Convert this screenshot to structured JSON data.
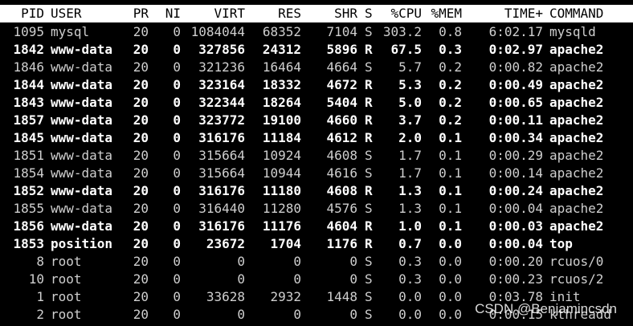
{
  "header": {
    "pid": "PID",
    "user": "USER",
    "pr": "PR",
    "ni": "NI",
    "virt": "VIRT",
    "res": "RES",
    "shr": "SHR",
    "s": "S",
    "cpu": "%CPU",
    "mem": "%MEM",
    "time": "TIME+",
    "command": "COMMAND"
  },
  "processes": [
    {
      "pid": "1095",
      "user": "mysql",
      "pr": "20",
      "ni": "0",
      "virt": "1084044",
      "res": "68352",
      "shr": "7104",
      "s": "S",
      "cpu": "303.2",
      "mem": "0.8",
      "time": "6:02.17",
      "command": "mysqld",
      "bold": false
    },
    {
      "pid": "1842",
      "user": "www-data",
      "pr": "20",
      "ni": "0",
      "virt": "327856",
      "res": "24312",
      "shr": "5896",
      "s": "R",
      "cpu": "67.5",
      "mem": "0.3",
      "time": "0:02.97",
      "command": "apache2",
      "bold": true
    },
    {
      "pid": "1846",
      "user": "www-data",
      "pr": "20",
      "ni": "0",
      "virt": "321236",
      "res": "16464",
      "shr": "4664",
      "s": "S",
      "cpu": "5.7",
      "mem": "0.2",
      "time": "0:00.82",
      "command": "apache2",
      "bold": false
    },
    {
      "pid": "1844",
      "user": "www-data",
      "pr": "20",
      "ni": "0",
      "virt": "323164",
      "res": "18332",
      "shr": "4672",
      "s": "R",
      "cpu": "5.3",
      "mem": "0.2",
      "time": "0:00.49",
      "command": "apache2",
      "bold": true
    },
    {
      "pid": "1843",
      "user": "www-data",
      "pr": "20",
      "ni": "0",
      "virt": "322344",
      "res": "18264",
      "shr": "5404",
      "s": "R",
      "cpu": "5.0",
      "mem": "0.2",
      "time": "0:00.65",
      "command": "apache2",
      "bold": true
    },
    {
      "pid": "1857",
      "user": "www-data",
      "pr": "20",
      "ni": "0",
      "virt": "323772",
      "res": "19100",
      "shr": "4660",
      "s": "R",
      "cpu": "3.7",
      "mem": "0.2",
      "time": "0:00.11",
      "command": "apache2",
      "bold": true
    },
    {
      "pid": "1845",
      "user": "www-data",
      "pr": "20",
      "ni": "0",
      "virt": "316176",
      "res": "11184",
      "shr": "4612",
      "s": "R",
      "cpu": "2.0",
      "mem": "0.1",
      "time": "0:00.34",
      "command": "apache2",
      "bold": true
    },
    {
      "pid": "1851",
      "user": "www-data",
      "pr": "20",
      "ni": "0",
      "virt": "315664",
      "res": "10924",
      "shr": "4608",
      "s": "S",
      "cpu": "1.7",
      "mem": "0.1",
      "time": "0:00.29",
      "command": "apache2",
      "bold": false
    },
    {
      "pid": "1854",
      "user": "www-data",
      "pr": "20",
      "ni": "0",
      "virt": "315664",
      "res": "10944",
      "shr": "4616",
      "s": "S",
      "cpu": "1.7",
      "mem": "0.1",
      "time": "0:00.14",
      "command": "apache2",
      "bold": false
    },
    {
      "pid": "1852",
      "user": "www-data",
      "pr": "20",
      "ni": "0",
      "virt": "316176",
      "res": "11180",
      "shr": "4608",
      "s": "R",
      "cpu": "1.3",
      "mem": "0.1",
      "time": "0:00.24",
      "command": "apache2",
      "bold": true
    },
    {
      "pid": "1855",
      "user": "www-data",
      "pr": "20",
      "ni": "0",
      "virt": "316440",
      "res": "11280",
      "shr": "4576",
      "s": "S",
      "cpu": "1.3",
      "mem": "0.1",
      "time": "0:00.04",
      "command": "apache2",
      "bold": false
    },
    {
      "pid": "1856",
      "user": "www-data",
      "pr": "20",
      "ni": "0",
      "virt": "316176",
      "res": "11176",
      "shr": "4604",
      "s": "R",
      "cpu": "1.0",
      "mem": "0.1",
      "time": "0:00.03",
      "command": "apache2",
      "bold": true
    },
    {
      "pid": "1853",
      "user": "position",
      "pr": "20",
      "ni": "0",
      "virt": "23672",
      "res": "1704",
      "shr": "1176",
      "s": "R",
      "cpu": "0.7",
      "mem": "0.0",
      "time": "0:00.04",
      "command": "top",
      "bold": true
    },
    {
      "pid": "8",
      "user": "root",
      "pr": "20",
      "ni": "0",
      "virt": "0",
      "res": "0",
      "shr": "0",
      "s": "S",
      "cpu": "0.3",
      "mem": "0.0",
      "time": "0:00.20",
      "command": "rcuos/0",
      "bold": false
    },
    {
      "pid": "10",
      "user": "root",
      "pr": "20",
      "ni": "0",
      "virt": "0",
      "res": "0",
      "shr": "0",
      "s": "S",
      "cpu": "0.3",
      "mem": "0.0",
      "time": "0:00.23",
      "command": "rcuos/2",
      "bold": false
    },
    {
      "pid": "1",
      "user": "root",
      "pr": "20",
      "ni": "0",
      "virt": "33628",
      "res": "2932",
      "shr": "1448",
      "s": "S",
      "cpu": "0.0",
      "mem": "0.0",
      "time": "0:03.78",
      "command": "init",
      "bold": false
    },
    {
      "pid": "2",
      "user": "root",
      "pr": "20",
      "ni": "0",
      "virt": "0",
      "res": "0",
      "shr": "0",
      "s": "S",
      "cpu": "0.0",
      "mem": "0.0",
      "time": "0:00.15",
      "command": "kthreadd",
      "bold": false
    }
  ],
  "watermark": "CSDN @Benjamincsdn",
  "colors": {
    "background": "#000000",
    "header_background": "#ffffff",
    "header_text": "#000000",
    "bold_text": "#ffffff",
    "normal_text": "#cfcfcf"
  }
}
